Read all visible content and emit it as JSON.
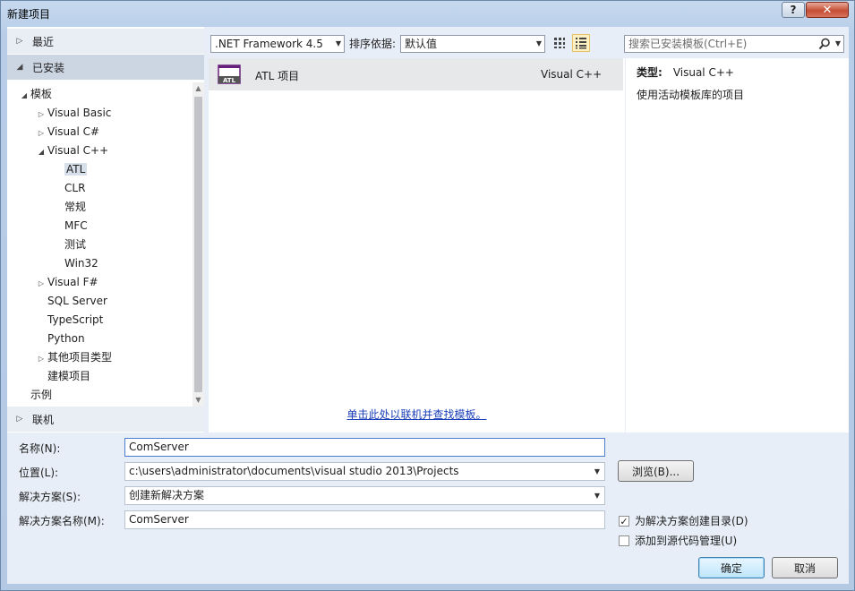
{
  "window": {
    "title": "新建项目",
    "help_label": "?",
    "close_label": "✕"
  },
  "left": {
    "recent": "最近",
    "installed": "已安装",
    "online": "联机",
    "tree": [
      {
        "label": "模板",
        "expander": "◢"
      },
      {
        "label": "Visual Basic",
        "expander": "▷"
      },
      {
        "label": "Visual C#",
        "expander": "▷"
      },
      {
        "label": "Visual C++",
        "expander": "◢"
      },
      {
        "label": "ATL",
        "expander": "",
        "selected": true
      },
      {
        "label": "CLR",
        "expander": ""
      },
      {
        "label": "常规",
        "expander": ""
      },
      {
        "label": "MFC",
        "expander": ""
      },
      {
        "label": "测试",
        "expander": ""
      },
      {
        "label": "Win32",
        "expander": ""
      },
      {
        "label": "Visual F#",
        "expander": "▷"
      },
      {
        "label": "SQL Server",
        "expander": ""
      },
      {
        "label": "TypeScript",
        "expander": ""
      },
      {
        "label": "Python",
        "expander": ""
      },
      {
        "label": "其他项目类型",
        "expander": "▷"
      },
      {
        "label": "建模项目",
        "expander": ""
      },
      {
        "label": "示例",
        "expander": ""
      }
    ]
  },
  "toolbar": {
    "framework": ".NET Framework 4.5",
    "sort_label": "排序依据:",
    "sort_value": "默认值",
    "search_placeholder": "搜索已安装模板(Ctrl+E)"
  },
  "templates": [
    {
      "name": "ATL 项目",
      "language": "Visual C++",
      "icon": "atl-project-icon",
      "icon_text": "ATL"
    }
  ],
  "online_link": "单击此处以联机并查找模板。",
  "details": {
    "type_label": "类型:",
    "type_value": "Visual C++",
    "description": "使用活动模板库的项目"
  },
  "form": {
    "name_label": "名称(N):",
    "name_value": "ComServer",
    "location_label": "位置(L):",
    "location_value": "c:\\users\\administrator\\documents\\visual studio 2013\\Projects",
    "solution_label": "解决方案(S):",
    "solution_value": "创建新解决方案",
    "solution_name_label": "解决方案名称(M):",
    "solution_name_value": "ComServer",
    "browse_label": "浏览(B)...",
    "create_dir_label": "为解决方案创建目录(D)",
    "create_dir_checked": true,
    "source_control_label": "添加到源代码管理(U)",
    "source_control_checked": false,
    "ok_label": "确定",
    "cancel_label": "取消"
  },
  "colors": {
    "accent": "#3c7fb1",
    "link": "#1b3fb8",
    "icon_purple": "#68217a"
  }
}
